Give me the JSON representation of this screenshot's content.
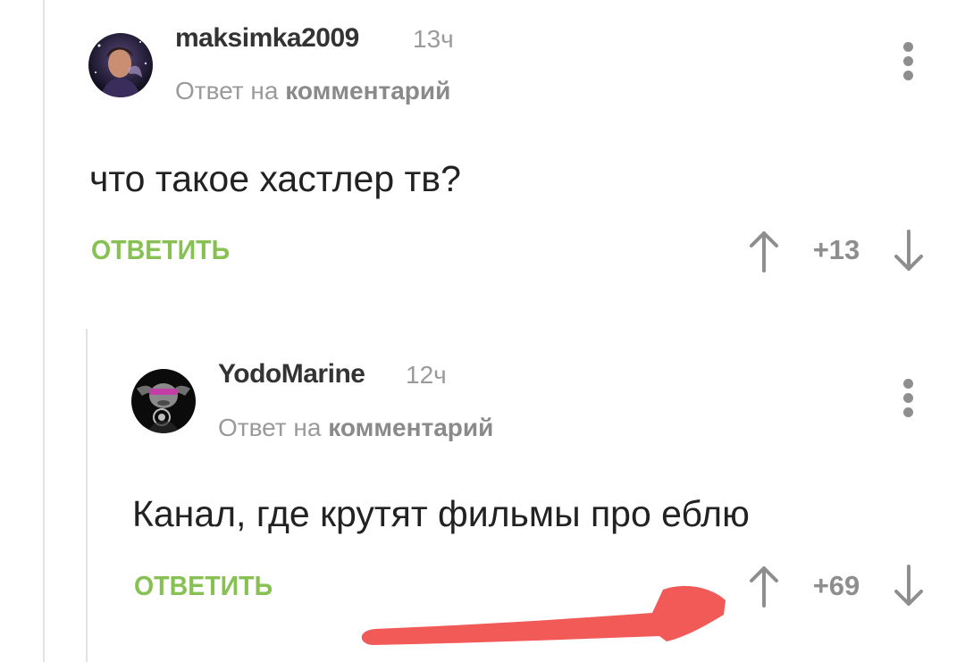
{
  "comments": [
    {
      "username": "maksimka2009",
      "time": "13ч",
      "reply_prefix": "Ответ на",
      "reply_link": "комментарий",
      "text": "что такое хастлер тв?",
      "reply_label": "ОТВЕТИТЬ",
      "rating": "+13"
    },
    {
      "username": "YodoMarine",
      "time": "12ч",
      "reply_prefix": "Ответ на",
      "reply_link": "комментарий",
      "text": "Канал, где крутят фильмы про еблю",
      "reply_label": "ОТВЕТИТЬ",
      "rating": "+69"
    }
  ],
  "colors": {
    "reply_green": "#88c153",
    "annotation_red": "#f25a57",
    "meta_gray": "#9a9a9a"
  },
  "icons": {
    "vote_up": "arrow-up-icon",
    "vote_down": "arrow-down-icon",
    "more": "more-vertical-icon",
    "annotation": "red-arrow-annotation"
  }
}
